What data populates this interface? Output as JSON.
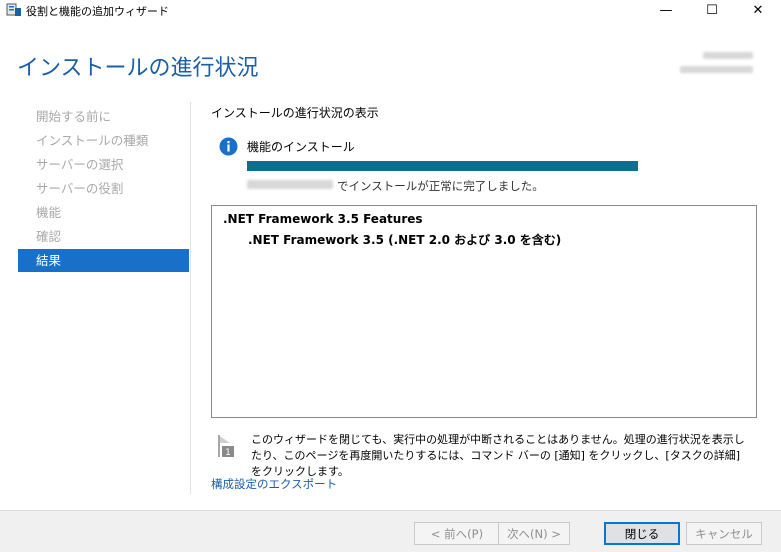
{
  "window": {
    "title": "役割と機能の追加ウィザード",
    "minimize_glyph": "—",
    "maximize_glyph": "☐",
    "close_glyph": "✕"
  },
  "header": {
    "title": "インストールの進行状況"
  },
  "sidebar": {
    "items": [
      {
        "label": "開始する前に",
        "active": false
      },
      {
        "label": "インストールの種類",
        "active": false
      },
      {
        "label": "サーバーの選択",
        "active": false
      },
      {
        "label": "サーバーの役割",
        "active": false
      },
      {
        "label": "機能",
        "active": false
      },
      {
        "label": "確認",
        "active": false
      },
      {
        "label": "結果",
        "active": true
      }
    ]
  },
  "main": {
    "heading": "インストールの進行状況の表示",
    "status": {
      "icon": "info-icon",
      "label": "機能のインストール",
      "progress_fraction": 1.0,
      "message": "でインストールが正常に完了しました。"
    },
    "results": [
      ".NET Framework 3.5 Features",
      ".NET Framework 3.5 (.NET 2.0 および 3.0 を含む)"
    ],
    "note": "このウィザードを閉じても、実行中の処理が中断されることはありません。処理の進行状況を表示したり、このページを再度開いたりするには、コマンド バーの [通知] をクリックし、[タスクの詳細] をクリックします。",
    "note_icon": "flag-notification-icon",
    "note_badge": "1",
    "export_link": "構成設定のエクスポート"
  },
  "footer": {
    "prev_label": "< 前へ(P)",
    "next_label": "次へ(N) >",
    "close_label": "閉じる",
    "cancel_label": "キャンセル"
  },
  "colors": {
    "accent": "#1870c9",
    "title_blue": "#1a5fa8",
    "progress": "#0f6e8f"
  }
}
